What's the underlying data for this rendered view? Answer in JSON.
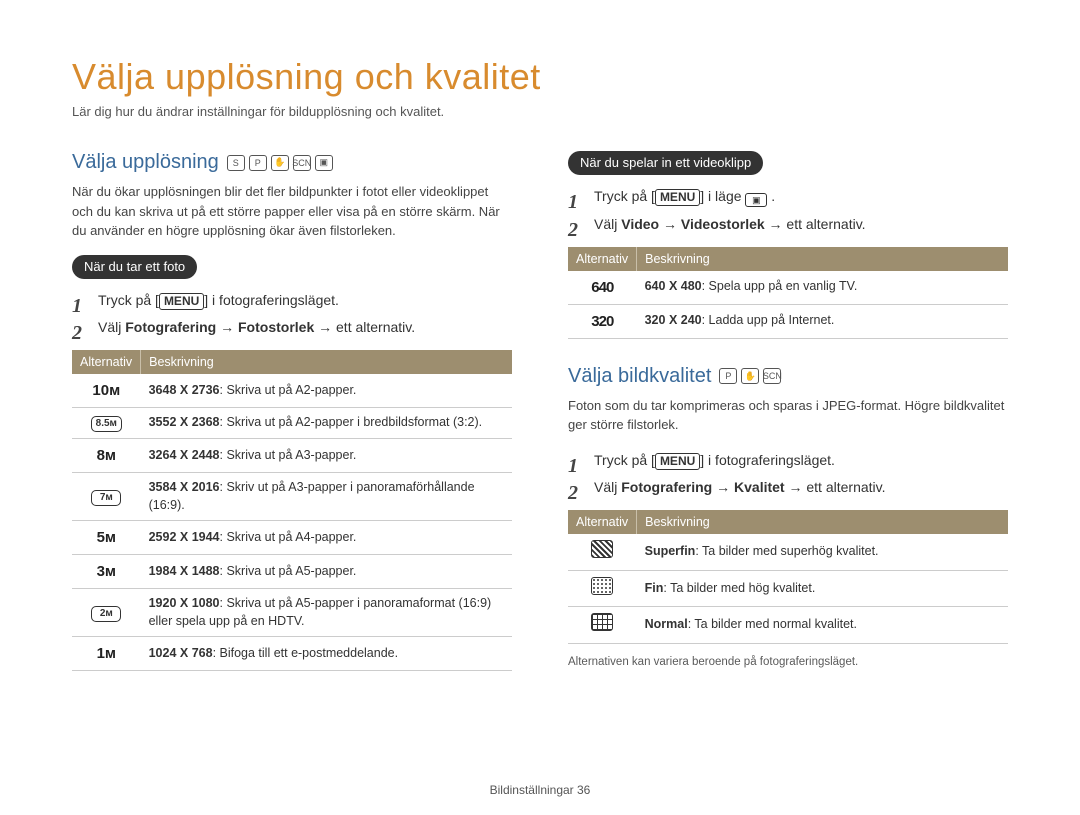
{
  "title": "Välja upplösning och kvalitet",
  "subtitle": "Lär dig hur du ändrar inställningar för bildupplösning och kvalitet.",
  "left": {
    "heading": "Välja upplösning",
    "icons": [
      "S",
      "P",
      "✋",
      "SCN",
      "▣"
    ],
    "intro": "När du ökar upplösningen blir det fler bildpunkter i fotot eller videoklippet och du kan skriva ut på ett större papper eller visa på en större skärm. När du använder en högre upplösning ökar även filstorleken.",
    "pill": "När du tar ett foto",
    "step1_a": "Tryck på [",
    "step1_menu": "MENU",
    "step1_b": "] i fotograferingsläget.",
    "step2_a": "Välj ",
    "step2_bold": "Fotografering → Fotostorlek",
    "step2_b": " → ett alternativ.",
    "th_a": "Alternativ",
    "th_b": "Beskrivning",
    "rows": [
      {
        "icon": "10ᴍ",
        "boxed": false,
        "res": "3648 X 2736",
        "desc": ": Skriva ut på A2-papper."
      },
      {
        "icon": "8.5ᴍ",
        "boxed": true,
        "res": "3552 X 2368",
        "desc": ": Skriva ut på A2-papper i bredbildsformat (3:2)."
      },
      {
        "icon": "8ᴍ",
        "boxed": false,
        "res": "3264 X 2448",
        "desc": ": Skriva ut på A3-papper."
      },
      {
        "icon": "7ᴍ",
        "boxed": true,
        "res": "3584 X 2016",
        "desc": ": Skriv ut på A3-papper i panoramaförhållande (16:9)."
      },
      {
        "icon": "5ᴍ",
        "boxed": false,
        "res": "2592 X 1944",
        "desc": ": Skriva ut på A4-papper."
      },
      {
        "icon": "3ᴍ",
        "boxed": false,
        "res": "1984 X 1488",
        "desc": ": Skriva ut på A5-papper."
      },
      {
        "icon": "2ᴍ",
        "boxed": true,
        "res": "1920 X 1080",
        "desc": ": Skriva ut på A5-papper i panoramaformat (16:9) eller spela upp på en HDTV."
      },
      {
        "icon": "1ᴍ",
        "boxed": false,
        "res": "1024 X 768",
        "desc": ": Bifoga till ett e-postmeddelande."
      }
    ]
  },
  "right": {
    "pill": "När du spelar in ett videoklipp",
    "step1_a": "Tryck på [",
    "step1_menu": "MENU",
    "step1_b": "] i läge ",
    "step2_a": "Välj ",
    "step2_bold": "Video → Videostorlek",
    "step2_b": " → ett alternativ.",
    "th_a": "Alternativ",
    "th_b": "Beskrivning",
    "rows": [
      {
        "icon": "640",
        "res": "640 X 480",
        "desc": ": Spela upp på en vanlig TV."
      },
      {
        "icon": "320",
        "res": "320 X 240",
        "desc": ": Ladda upp på Internet."
      }
    ],
    "heading2": "Välja bildkvalitet",
    "icons2": [
      "P",
      "✋",
      "SCN"
    ],
    "intro2": "Foton som du tar komprimeras och sparas i JPEG-format. Högre bildkvalitet ger större filstorlek.",
    "q_step1_a": "Tryck på [",
    "q_step1_menu": "MENU",
    "q_step1_b": "] i fotograferingsläget.",
    "q_step2_a": "Välj ",
    "q_step2_bold": "Fotografering → Kvalitet",
    "q_step2_b": " → ett alternativ.",
    "q_rows": [
      {
        "cls": "qual-sf",
        "res": "Superfin",
        "desc": ": Ta bilder med superhög kvalitet."
      },
      {
        "cls": "qual-f",
        "res": "Fin",
        "desc": ": Ta bilder med hög kvalitet."
      },
      {
        "cls": "qual-n",
        "res": "Normal",
        "desc": ": Ta bilder med normal kvalitet."
      }
    ],
    "footnote": "Alternativen kan variera beroende på fotograferingsläget."
  },
  "footer": "Bildinställningar  36"
}
